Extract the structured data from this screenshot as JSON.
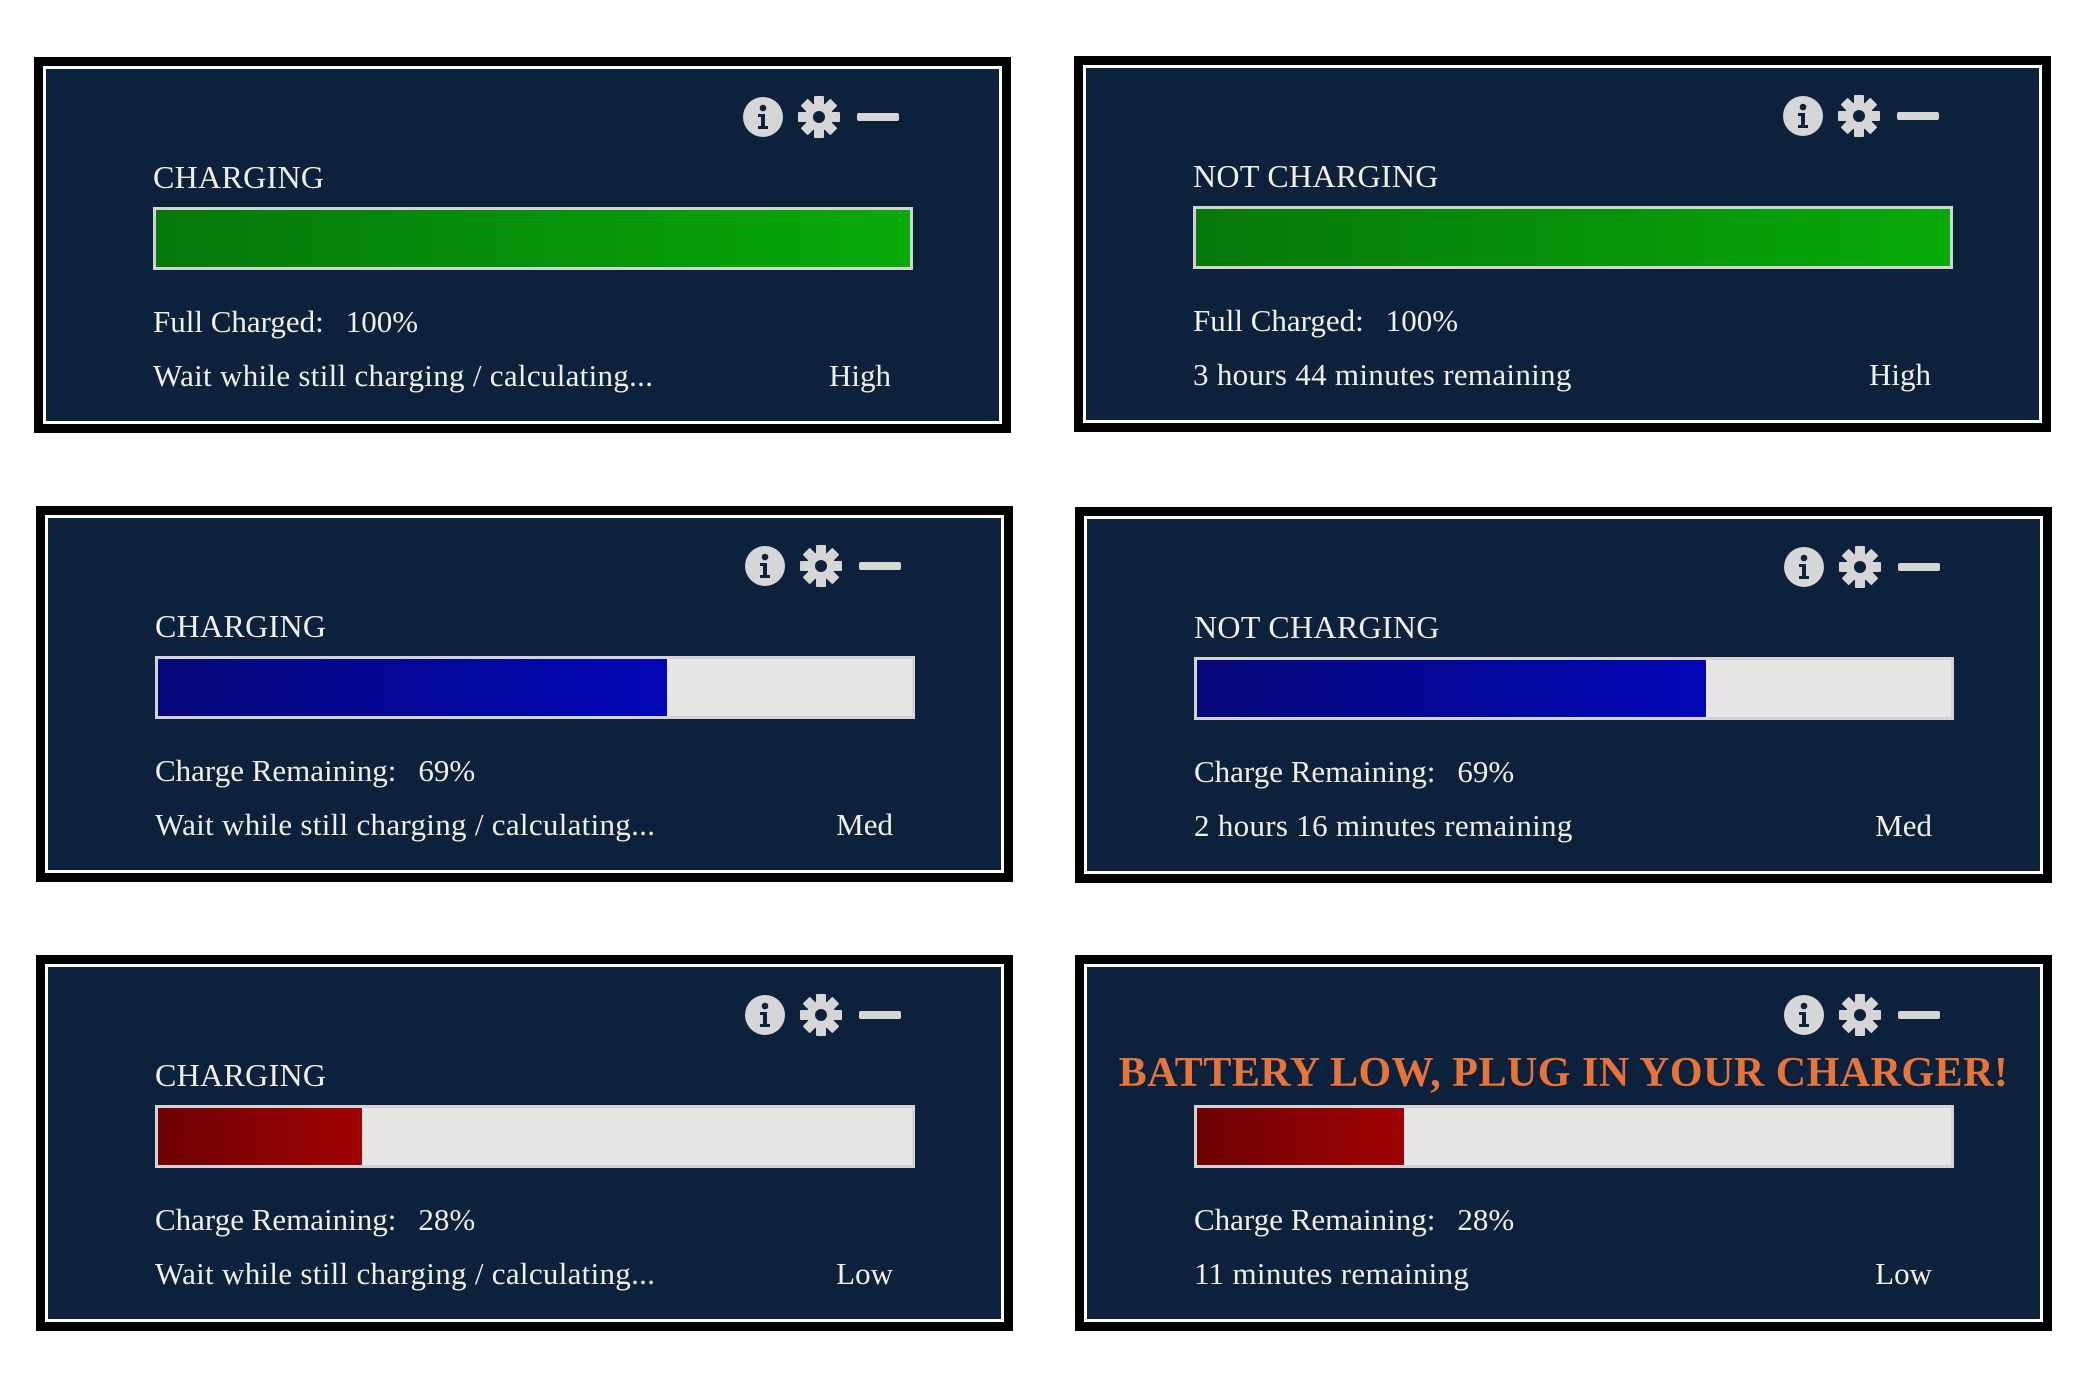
{
  "colors": {
    "panel_background": "#0c223c",
    "text": "#f1efe6",
    "alert": "#e8743a",
    "bar_track": "#e6e6e6",
    "high": "#07aa09",
    "med": "#0206b6",
    "low": "#a00202"
  },
  "panels": [
    {
      "icons": [
        "info-icon",
        "gear-icon",
        "minimize-icon"
      ],
      "status": "CHARGING",
      "alert": false,
      "charge_fraction": 1.0,
      "fill": "green",
      "reading_label": "Full Charged:",
      "reading_value": "100%",
      "message": "Wait while still charging / calculating...",
      "level": "High"
    },
    {
      "icons": [
        "info-icon",
        "gear-icon",
        "minimize-icon"
      ],
      "status": "NOT CHARGING",
      "alert": false,
      "charge_fraction": 1.0,
      "fill": "green",
      "reading_label": "Full Charged:",
      "reading_value": "100%",
      "message": "3 hours 44 minutes remaining",
      "level": "High"
    },
    {
      "icons": [
        "info-icon",
        "gear-icon",
        "minimize-icon"
      ],
      "status": "CHARGING",
      "alert": false,
      "charge_fraction": 0.675,
      "fill": "blue",
      "reading_label": "Charge Remaining:",
      "reading_value": "69%",
      "message": "Wait while still charging / calculating...",
      "level": "Med"
    },
    {
      "icons": [
        "info-icon",
        "gear-icon",
        "minimize-icon"
      ],
      "status": "NOT CHARGING",
      "alert": false,
      "charge_fraction": 0.675,
      "fill": "blue",
      "reading_label": "Charge Remaining:",
      "reading_value": "69%",
      "message": "2 hours 16 minutes remaining",
      "level": "Med"
    },
    {
      "icons": [
        "info-icon",
        "gear-icon",
        "minimize-icon"
      ],
      "status": "CHARGING",
      "alert": false,
      "charge_fraction": 0.27,
      "fill": "red",
      "reading_label": "Charge Remaining:",
      "reading_value": "28%",
      "message": "Wait while still charging / calculating...",
      "level": "Low"
    },
    {
      "icons": [
        "info-icon",
        "gear-icon",
        "minimize-icon"
      ],
      "status": "BATTERY LOW, PLUG IN YOUR CHARGER!",
      "alert": true,
      "charge_fraction": 0.275,
      "fill": "red",
      "reading_label": "Charge Remaining:",
      "reading_value": "28%",
      "message": "11 minutes remaining",
      "level": "Low"
    }
  ]
}
